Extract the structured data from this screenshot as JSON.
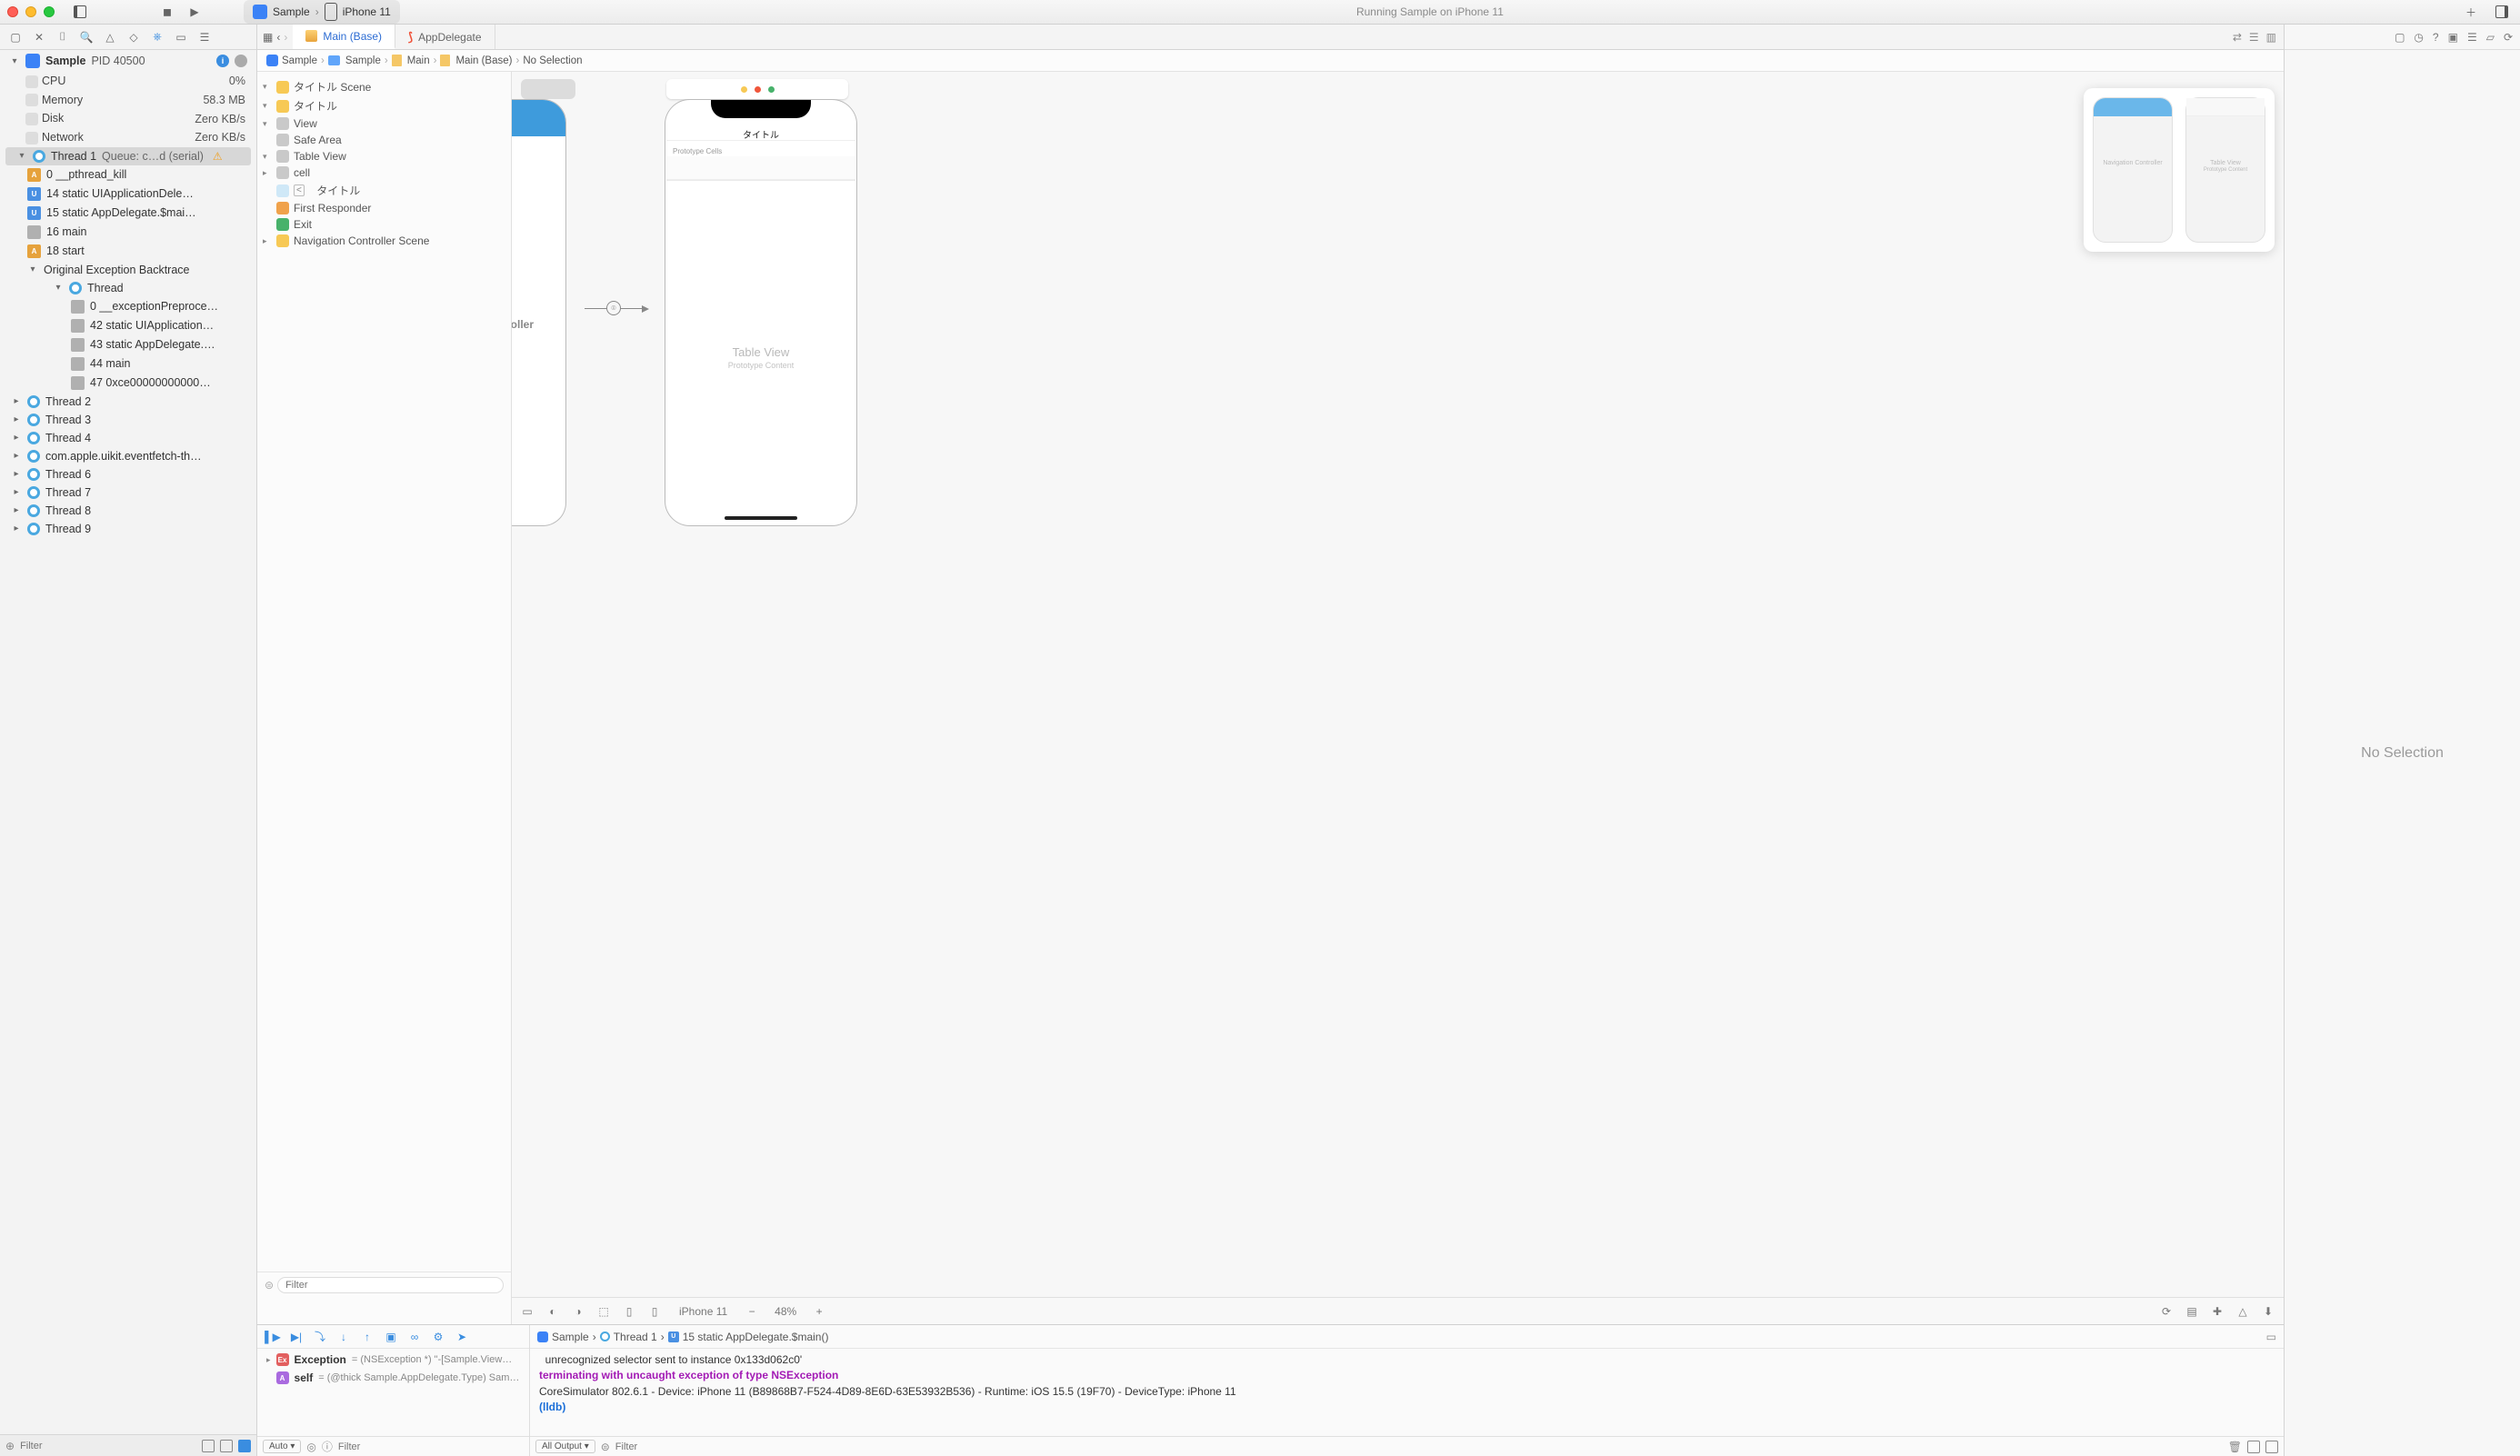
{
  "titlebar": {
    "app_name": "Sample",
    "scheme_app": "Sample",
    "scheme_device": "iPhone 11",
    "status": "Running Sample on iPhone 11"
  },
  "left": {
    "process_name": "Sample",
    "pid_label": "PID 40500",
    "gauges": {
      "cpu_label": "CPU",
      "cpu_val": "0%",
      "mem_label": "Memory",
      "mem_val": "58.3 MB",
      "disk_label": "Disk",
      "disk_val": "Zero KB/s",
      "net_label": "Network",
      "net_val": "Zero KB/s"
    },
    "thread1": {
      "title": "Thread 1",
      "queue": "Queue: c…d (serial)"
    },
    "frames": {
      "f0": "0 __pthread_kill",
      "f14": "14 static UIApplicationDele…",
      "f15": "15 static AppDelegate.$mai…",
      "f16": "16 main",
      "f18": "18 start",
      "oeb": "Original Exception Backtrace",
      "thread_lbl": "Thread",
      "e0": "0 __exceptionPreproce…",
      "e42": "42 static UIApplication…",
      "e43": "43 static AppDelegate.…",
      "e44": "44 main",
      "e47": "47 0xce00000000000…",
      "t2": "Thread 2",
      "t3": "Thread 3",
      "t4": "Thread 4",
      "tevent": "com.apple.uikit.eventfetch-th…",
      "t6": "Thread 6",
      "t7": "Thread 7",
      "t8": "Thread 8",
      "t9": "Thread 9"
    },
    "filter_placeholder": "Filter"
  },
  "tabs": {
    "main": "Main (Base)",
    "appdelegate": "AppDelegate"
  },
  "path": {
    "p1": "Sample",
    "p2": "Sample",
    "p3": "Main",
    "p4": "Main (Base)",
    "p5": "No Selection"
  },
  "outline": {
    "scene1": "タイトル Scene",
    "title": "タイトル",
    "view": "View",
    "safe": "Safe Area",
    "tv": "Table View",
    "cell": "cell",
    "navitem": "タイトル",
    "fr": "First Responder",
    "exit": "Exit",
    "scene2": "Navigation Controller Scene",
    "filter_placeholder": "Filter"
  },
  "canvas": {
    "nav_lbl": "roller",
    "scene_title": "タイトル",
    "proto": "Prototype Cells",
    "tv": "Table View",
    "tv_sub": "Prototype Content",
    "mm_nav": "Navigation Controller",
    "mm_tv": "Table View",
    "mm_tv_sub": "Prototype Content"
  },
  "ib_bottom": {
    "device": "iPhone 11",
    "zoom": "48%"
  },
  "debug": {
    "console_path": {
      "p1": "Sample",
      "p2": "Thread 1",
      "p3": "15 static AppDelegate.$main()"
    },
    "vars": {
      "exc_name": "Exception",
      "exc_val": "= (NSException *) \"-[Sample.View…",
      "self_name": "self",
      "self_val": "= (@thick Sample.AppDelegate.Type) Sam…"
    },
    "console_line1": "  unrecognized selector sent to instance 0x133d062c0'",
    "console_line2": "terminating with uncaught exception of type NSException",
    "console_line3": "CoreSimulator 802.6.1 - Device: iPhone 11 (B89868B7-F524-4D89-8E6D-63E53932B536) - Runtime: iOS 15.5 (19F70) - DeviceType: iPhone 11",
    "console_prompt": "(lldb)",
    "filter_placeholder": "Filter",
    "auto_label": "Auto ▾",
    "all_output_label": "All Output ▾"
  },
  "inspector": {
    "no_selection": "No Selection"
  }
}
